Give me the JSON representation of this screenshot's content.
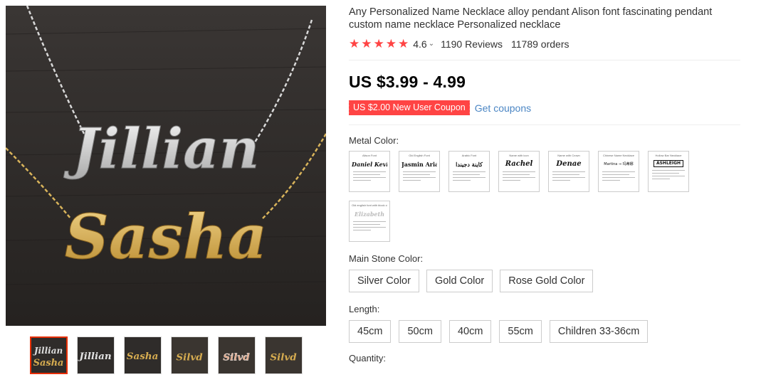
{
  "gallery": {
    "main_image": {
      "line1": "Jillian",
      "line2": "Sasha"
    },
    "thumbnails": [
      {
        "line1": "Jillian",
        "line2": "Sasha",
        "style": "silver-gold"
      },
      {
        "line1": "Jillian",
        "line2": "",
        "style": "silver"
      },
      {
        "line1": "Sasha",
        "line2": "",
        "style": "gold"
      },
      {
        "line1": "Silvd",
        "line2": "",
        "style": "gold"
      },
      {
        "line1": "Silvd",
        "line2": "",
        "style": "rose"
      },
      {
        "line1": "Silvd",
        "line2": "",
        "style": "gold"
      }
    ]
  },
  "product": {
    "title": "Any Personalized Name Necklace alloy pendant Alison font fascinating pendant custom name necklace Personalized necklace",
    "rating": "4.6",
    "reviews": "1190 Reviews",
    "orders": "11789 orders",
    "price": "US $3.99 - 4.99",
    "coupon": "US $2.00 New User Coupon",
    "get_coupons": "Get coupons"
  },
  "props": {
    "metal_label": "Metal Color:",
    "metal_options": [
      {
        "head": "Alison Font",
        "name": "Daniel  Kevin"
      },
      {
        "head": "Old English Font",
        "name": "Jasmin  Ariana"
      },
      {
        "head": "Arabic Font",
        "name": "كاينة  دجيندا"
      },
      {
        "head": "Name with icon",
        "name": "Rachel"
      },
      {
        "head": "Name with Crown",
        "name": "Denae"
      },
      {
        "head": "Chinese Name Necklace",
        "name": "Martina ⇒ 玛蒂娜"
      },
      {
        "head": "Hollow Bar Necklace",
        "name": "ASHLEIGH"
      },
      {
        "head": "Old english font with block chain",
        "name": "Elizabeth"
      }
    ],
    "stone_label": "Main Stone Color:",
    "stone_options": [
      "Silver Color",
      "Gold Color",
      "Rose Gold Color"
    ],
    "length_label": "Length:",
    "length_options": [
      "45cm",
      "50cm",
      "40cm",
      "55cm",
      "Children 33-36cm"
    ],
    "quantity_label": "Quantity:"
  },
  "colors": {
    "accent": "#ff4747",
    "link": "#4b86c4",
    "active_border": "#e62e04"
  }
}
